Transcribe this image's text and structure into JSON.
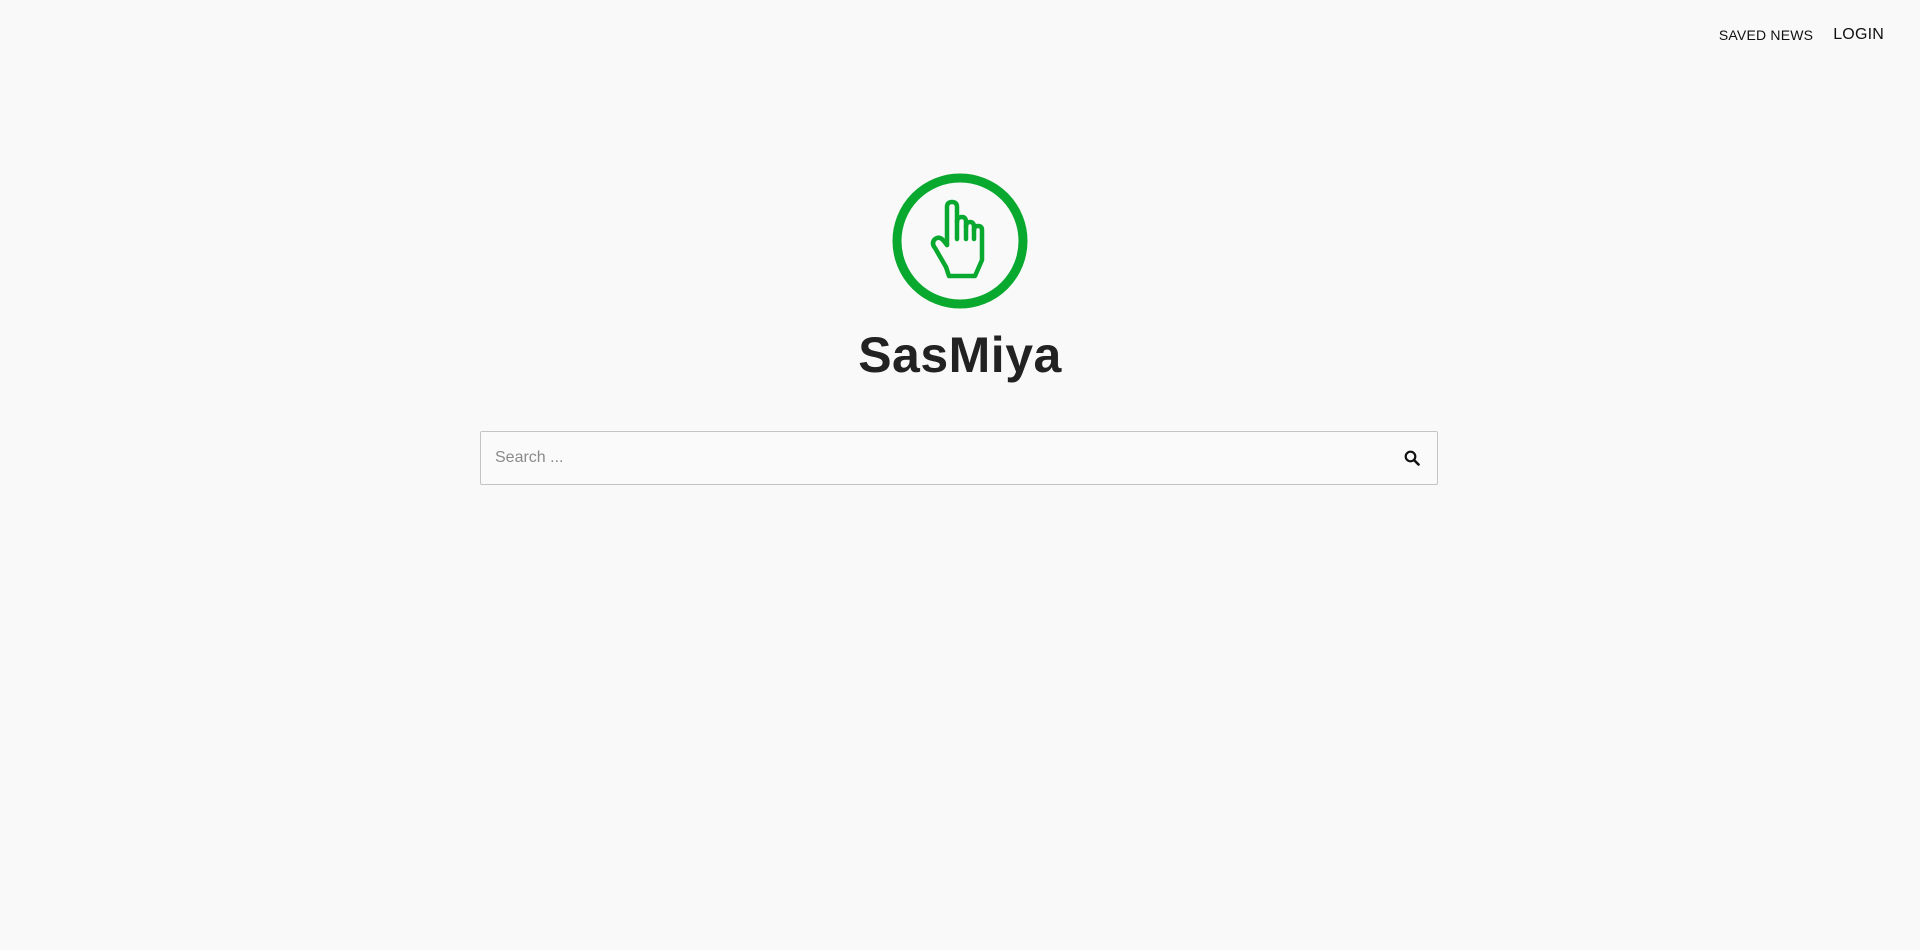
{
  "nav": {
    "saved_news_label": "SAVED NEWS",
    "login_label": "LOGIN"
  },
  "brand": {
    "name": "SasMiya",
    "logo_icon": "pointing-hand-icon",
    "accent_color": "#09a82e"
  },
  "search": {
    "placeholder": "Search ...",
    "value": "",
    "icon": "search-icon"
  }
}
